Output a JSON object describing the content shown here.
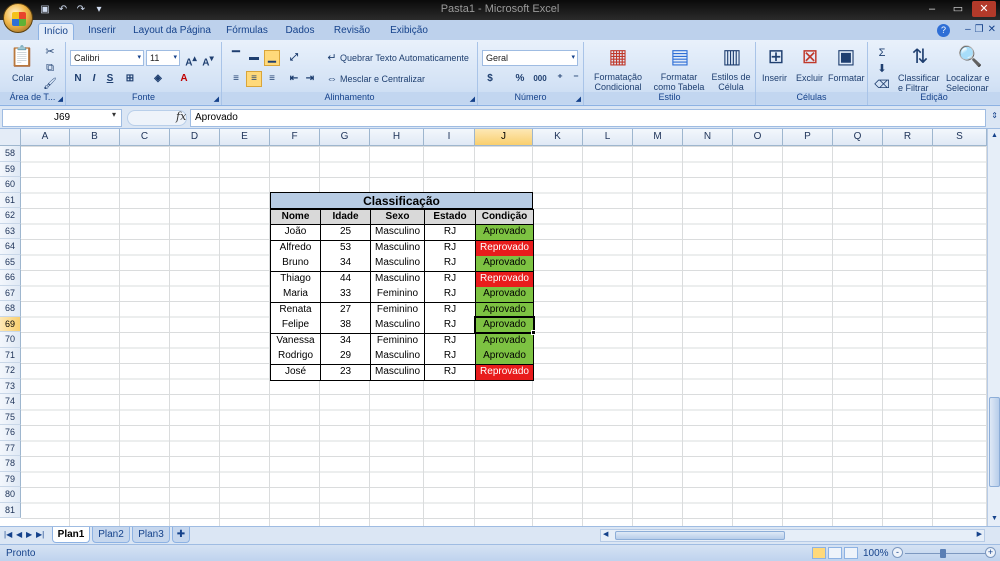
{
  "window": {
    "title": "Pasta1 - Microsoft Excel",
    "qat_icons": [
      "save-icon",
      "undo-icon",
      "redo-icon",
      "customize-icon"
    ]
  },
  "tabs": [
    "Início",
    "Inserir",
    "Layout da Página",
    "Fórmulas",
    "Dados",
    "Revisão",
    "Exibição"
  ],
  "active_tab": "Início",
  "ribbon": {
    "clipboard": {
      "label": "Área de T...",
      "paste": "Colar"
    },
    "font": {
      "label": "Fonte",
      "font_name": "Calibri",
      "font_size": "11",
      "bold": "N",
      "italic": "I",
      "underline": "S"
    },
    "alignment": {
      "label": "Alinhamento",
      "wrap_text": "Quebrar Texto Automaticamente",
      "merge_center": "Mesclar e Centralizar"
    },
    "number": {
      "label": "Número",
      "format": "Geral",
      "percent": "%",
      "thousands": "000"
    },
    "styles": {
      "label": "Estilo",
      "conditional": [
        "Formatação",
        "Condicional"
      ],
      "as_table": [
        "Formatar",
        "como Tabela"
      ],
      "cell_styles": [
        "Estilos de",
        "Célula"
      ]
    },
    "cells": {
      "label": "Células",
      "insert": "Inserir",
      "delete": "Excluir",
      "format": "Formatar"
    },
    "editing": {
      "label": "Edição",
      "sort": [
        "Classificar",
        "e Filtrar"
      ],
      "find": [
        "Localizar e",
        "Selecionar"
      ]
    }
  },
  "formula_bar": {
    "name_box": "J69",
    "fx": "fx",
    "content": "Aprovado"
  },
  "columns": [
    "A",
    "B",
    "C",
    "D",
    "E",
    "F",
    "G",
    "H",
    "I",
    "J",
    "K",
    "L",
    "M",
    "N",
    "O",
    "P",
    "Q",
    "R",
    "S"
  ],
  "selected_column": "J",
  "rows": [
    "58",
    "59",
    "60",
    "61",
    "62",
    "63",
    "64",
    "65",
    "66",
    "67",
    "68",
    "69",
    "70",
    "71",
    "72",
    "73",
    "74",
    "75",
    "76",
    "77",
    "78",
    "79",
    "80",
    "81"
  ],
  "selected_row": "69",
  "table": {
    "title": "Classificação",
    "headers": [
      "Nome",
      "Idade",
      "Sexo",
      "Estado",
      "Condição"
    ],
    "rows": [
      [
        "João",
        "25",
        "Masculino",
        "RJ",
        "Aprovado"
      ],
      [
        "Alfredo",
        "53",
        "Masculino",
        "RJ",
        "Reprovado"
      ],
      [
        "Bruno",
        "34",
        "Masculino",
        "RJ",
        "Aprovado"
      ],
      [
        "Thiago",
        "44",
        "Masculino",
        "RJ",
        "Reprovado"
      ],
      [
        "Maria",
        "33",
        "Feminino",
        "RJ",
        "Aprovado"
      ],
      [
        "Renata",
        "27",
        "Feminino",
        "RJ",
        "Aprovado"
      ],
      [
        "Felipe",
        "38",
        "Masculino",
        "RJ",
        "Aprovado"
      ],
      [
        "Vanessa",
        "34",
        "Feminino",
        "RJ",
        "Aprovado"
      ],
      [
        "Rodrigo",
        "29",
        "Masculino",
        "RJ",
        "Aprovado"
      ],
      [
        "José",
        "23",
        "Masculino",
        "RJ",
        "Reprovado"
      ]
    ],
    "approved_color": "#7dc242",
    "rejected_color": "#e81c1c"
  },
  "sheets": [
    "Plan1",
    "Plan2",
    "Plan3"
  ],
  "active_sheet": "Plan1",
  "status": {
    "text": "Pronto",
    "zoom": "100%",
    "zoom_out": "-",
    "zoom_in": "+"
  }
}
